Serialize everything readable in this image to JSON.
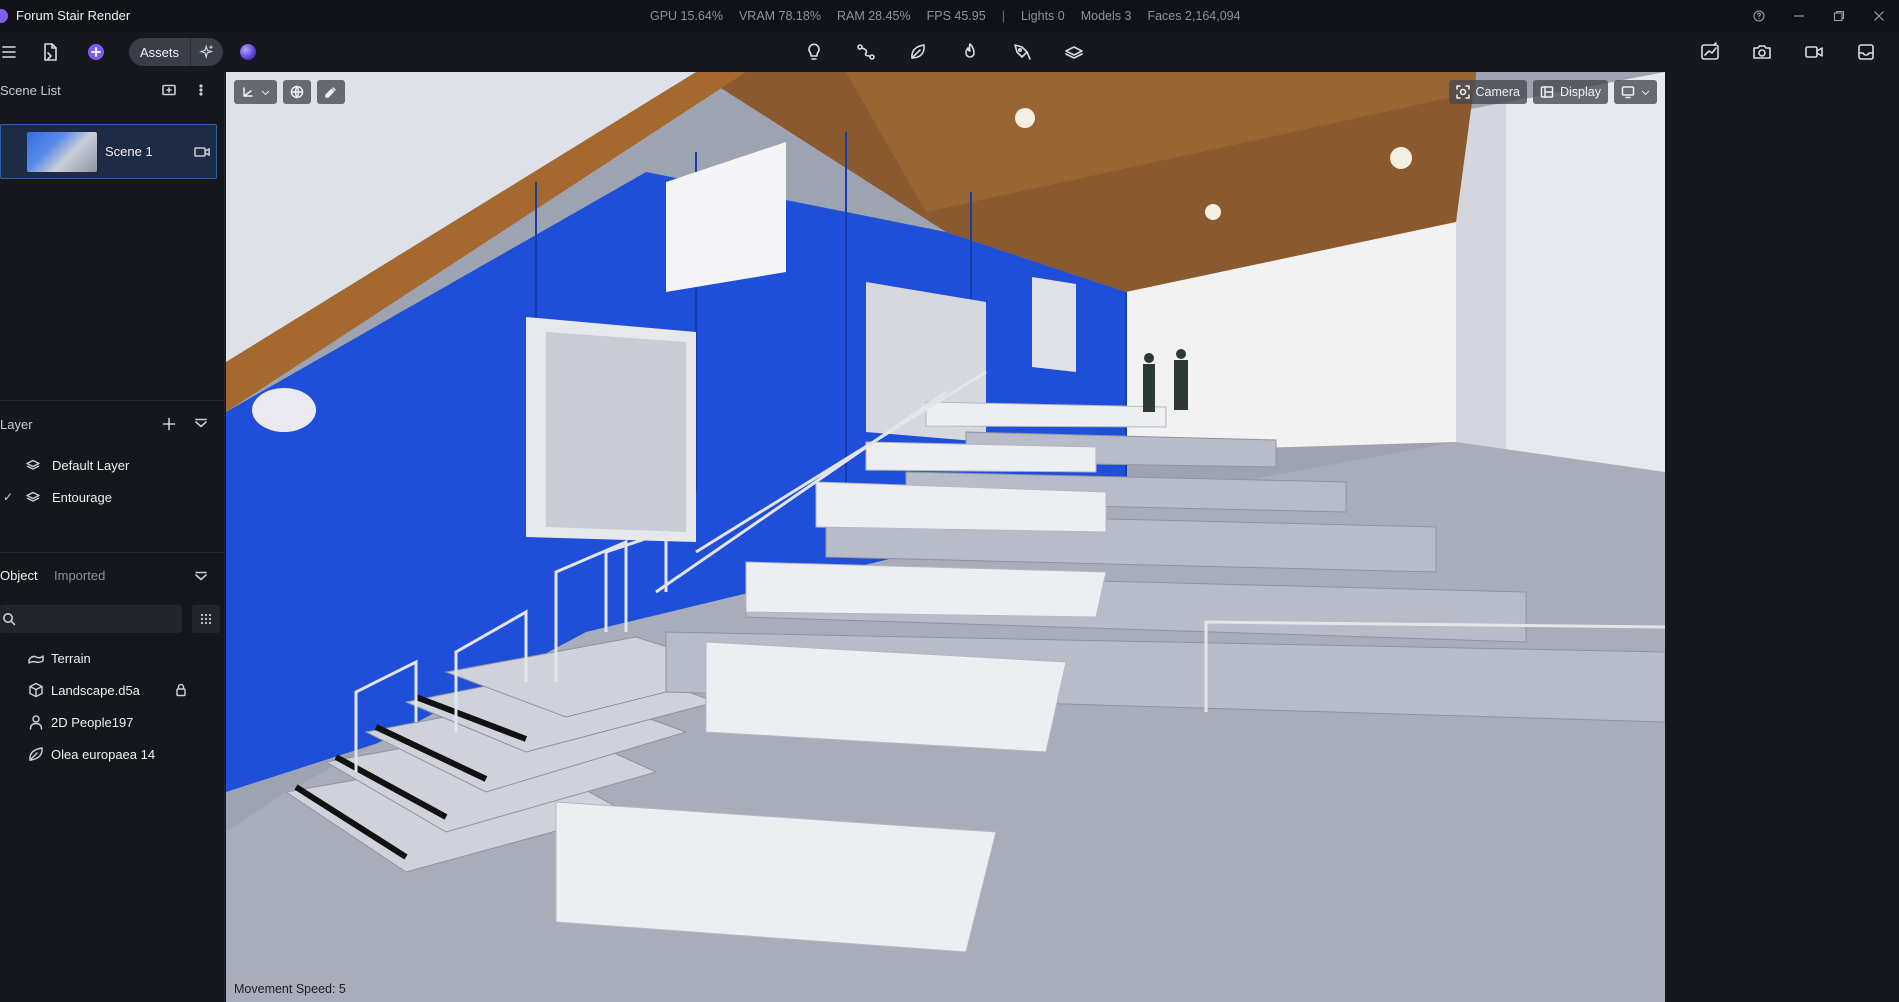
{
  "app": {
    "title": "Forum Stair Render"
  },
  "stats": {
    "gpu": "GPU 15.64%",
    "vram": "VRAM 78.18%",
    "ram": "RAM 28.45%",
    "fps": "FPS 45.95",
    "separator": "|",
    "lights": "Lights 0",
    "models": "Models 3",
    "faces": "Faces 2,164,094"
  },
  "toolbar": {
    "assets_label": "Assets",
    "center_tools": [
      "light-bulb-icon",
      "path-icon",
      "leaf-icon",
      "fire-icon",
      "pen-tool-icon",
      "layers-icon"
    ],
    "right_tools": [
      "chart-icon",
      "photo-camera-icon",
      "video-camera-icon",
      "inbox-icon"
    ]
  },
  "scene_list": {
    "title": "Scene List",
    "scenes": [
      {
        "name": "Scene 1"
      }
    ]
  },
  "layer": {
    "title": "Layer",
    "items": [
      {
        "name": "Default Layer",
        "checked": false
      },
      {
        "name": "Entourage",
        "checked": true
      }
    ],
    "check_glyph": "✓"
  },
  "object": {
    "tabs": [
      {
        "label": "Object",
        "active": true
      },
      {
        "label": "Imported",
        "active": false
      }
    ],
    "search_placeholder": "",
    "items": [
      {
        "name": "Terrain",
        "icon": "terrain-icon",
        "locked": false
      },
      {
        "name": "Landscape.d5a",
        "icon": "cube-icon",
        "locked": true
      },
      {
        "name": "2D People197",
        "icon": "person-icon",
        "locked": false
      },
      {
        "name": "Olea europaea 14",
        "icon": "leaf-icon",
        "locked": false
      }
    ]
  },
  "viewport": {
    "camera_label": "Camera",
    "display_label": "Display",
    "movement_speed": "Movement Speed: 5"
  },
  "colors": {
    "accent": "#2f5fa8",
    "wall_blue": "#1f4fd8",
    "panel_bg": "#15171c"
  }
}
